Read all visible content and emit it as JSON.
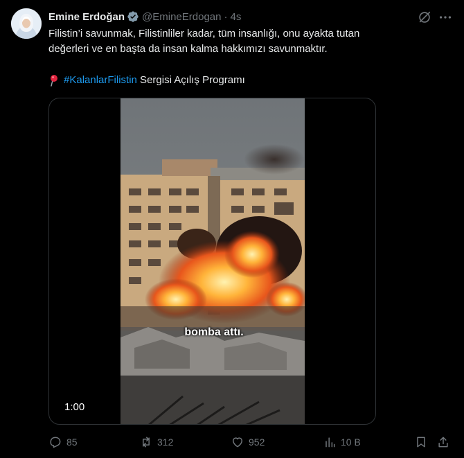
{
  "tweet": {
    "author_name": "Emine Erdoğan",
    "handle": "@EmineErdogan",
    "separator": "·",
    "time": "4s",
    "text_line1": "Filistin’i savunmak, Filistinliler kadar, tüm insanlığı, onu ayakta tutan",
    "text_line2": "değerleri ve en başta da insan kalma hakkımızı savunmaktır.",
    "pin_icon": "round-pushpin-icon",
    "hashtag": "#KalanlarFilistin",
    "text_line3_rest": " Sergisi Açılış Programı"
  },
  "media": {
    "caption": "bomba attı.",
    "duration": "1:00"
  },
  "actions": {
    "replies": "85",
    "reposts": "312",
    "likes": "952",
    "views": "10 B"
  },
  "icons": [
    "verified-badge-icon",
    "grok-icon",
    "more-icon",
    "reply-icon",
    "repost-icon",
    "like-icon",
    "views-icon",
    "bookmark-icon",
    "share-icon"
  ],
  "colors": {
    "background": "#000000",
    "text": "#e7e9ea",
    "muted": "#71767b",
    "accent": "#1d9bf0",
    "border": "#2f3336"
  }
}
